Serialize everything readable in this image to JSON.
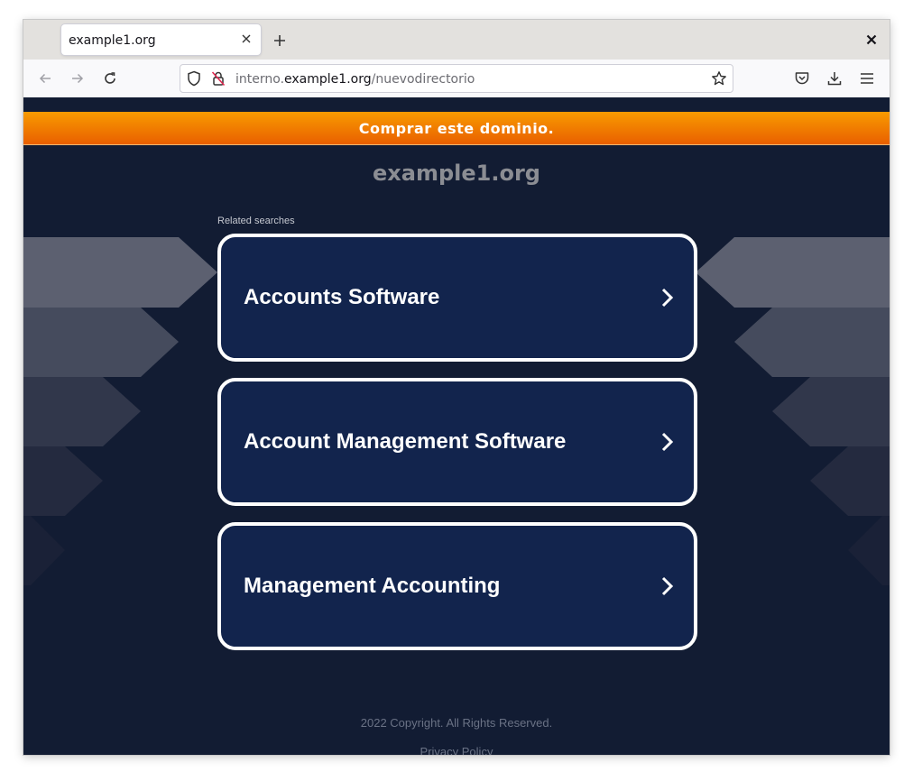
{
  "browser": {
    "tab_title": "example1.org",
    "url": {
      "subdomain": "interno.",
      "host": "example1.org",
      "path": "/nuevodirectorio"
    }
  },
  "page": {
    "banner_text": "Comprar este dominio.",
    "domain_title": "example1.org",
    "related_label": "Related searches",
    "results": [
      {
        "label": "Accounts Software"
      },
      {
        "label": "Account Management Software"
      },
      {
        "label": "Management Accounting"
      }
    ],
    "copyright": "2022 Copyright. All Rights Reserved.",
    "privacy_link": "Privacy Policy"
  },
  "colors": {
    "page_bg": "#121c33",
    "banner_orange": "#f18000",
    "result_bg": "#12244d",
    "result_border": "#ffffff"
  },
  "icons": [
    "close-icon",
    "plus-icon",
    "back-arrow-icon",
    "forward-arrow-icon",
    "reload-icon",
    "shield-icon",
    "lock-off-icon",
    "star-icon",
    "pocket-icon",
    "download-icon",
    "menu-icon",
    "chevron-right-icon"
  ]
}
